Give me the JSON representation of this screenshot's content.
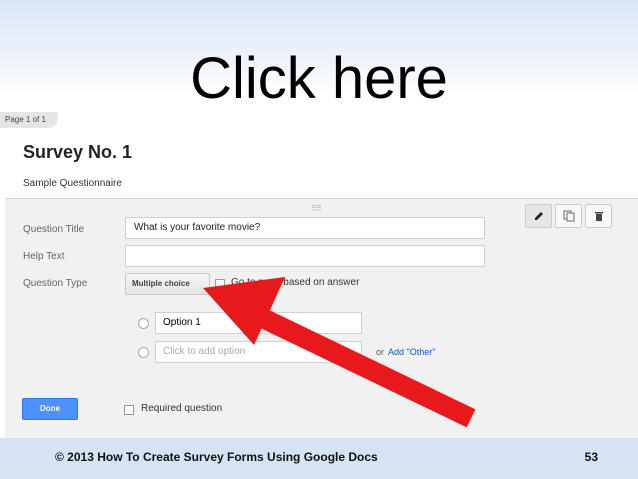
{
  "slide": {
    "title": "Click here",
    "footer": "© 2013 How To Create Survey Forms Using Google Docs",
    "page_number": "53"
  },
  "form": {
    "page_indicator": "Page 1 of 1",
    "title": "Survey No. 1",
    "description": "Sample Questionnaire",
    "drag_handle": "⠿⠿",
    "toolbar": {
      "icons": [
        "pencil-icon",
        "duplicate-icon",
        "trash-icon"
      ]
    },
    "labels": {
      "question_title": "Question Title",
      "help_text": "Help Text",
      "question_type": "Question Type"
    },
    "question_title_value": "What is your favorite movie?",
    "help_text_value": "",
    "question_type_value": "Multiple choice",
    "go_to_page_label": "Go to page based on answer",
    "options": [
      "Option 1"
    ],
    "add_option_placeholder": "Click to add option",
    "or_label": "or",
    "add_other_label": "Add \"Other\"",
    "done_label": "Done",
    "required_label": "Required question"
  },
  "colors": {
    "accent_blue": "#4d90fe",
    "link_blue": "#1155cc",
    "arrow_red": "#e8191c"
  }
}
